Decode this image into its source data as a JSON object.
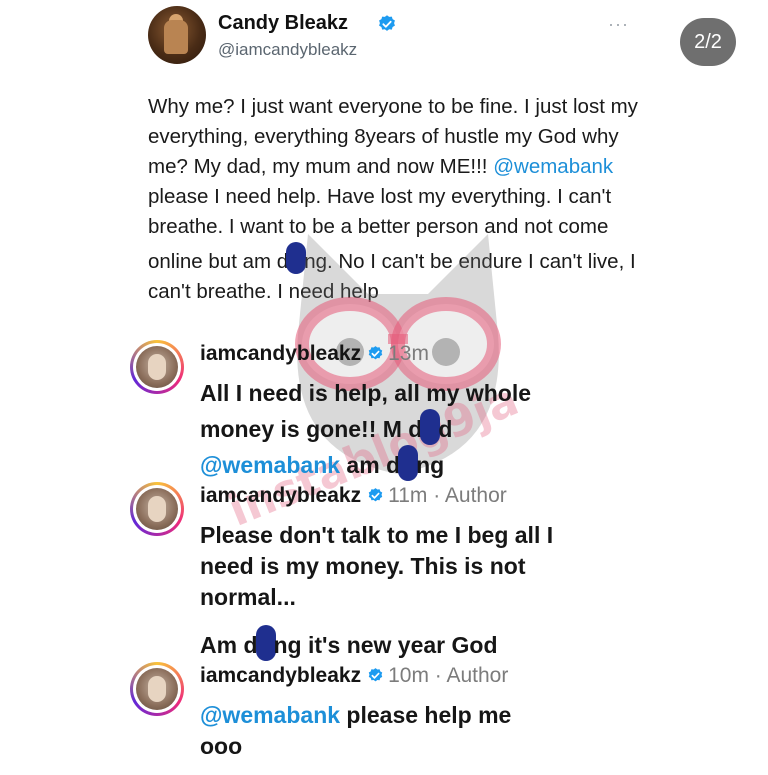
{
  "post": {
    "name": "Candy Bleakz",
    "handle": "@iamcandybleakz",
    "more": "···",
    "text_before_mention": "Why me? I just want everyone to be fine. I just lost my everything, everything 8years of hustle my God why me? My dad, my mum and now ME!!! ",
    "mention": "@wemabank",
    "text_after_mention_1": " please I need help. Have lost my everything. I can't breathe. I want to be a better person and not come online but am d",
    "text_after_mention_2": "ng. No I can't be endure I can't live, I can't breathe. I need help"
  },
  "page_counter": "2/2",
  "watermark": "instablog9ja",
  "comments": [
    {
      "username": "iamcandybleakz",
      "meta": "13m",
      "line1": "All I need is help, all my whole",
      "line2_a": "money is gone!! M d",
      "line2_b": "d",
      "line3_mention": "@wemabank",
      "line3_a": " am d",
      "line3_b": "ng"
    },
    {
      "username": "iamcandybleakz",
      "meta": "11m · Author",
      "para1": "Please don't talk to me I beg all I need is my money. This is not normal...",
      "para2_a": "Am d",
      "para2_b": "ng it's new year God"
    },
    {
      "username": "iamcandybleakz",
      "meta": "10m · Author",
      "mention": "@wemabank",
      "text": " please help me ooo"
    }
  ],
  "colors": {
    "mention": "#1d8fd8",
    "verified": "#1d9bf0",
    "redaction": "#1f2f8f",
    "page_counter_bg": "#6f6f6f"
  },
  "icons": [
    "verified-badge-icon",
    "more-options-icon"
  ]
}
